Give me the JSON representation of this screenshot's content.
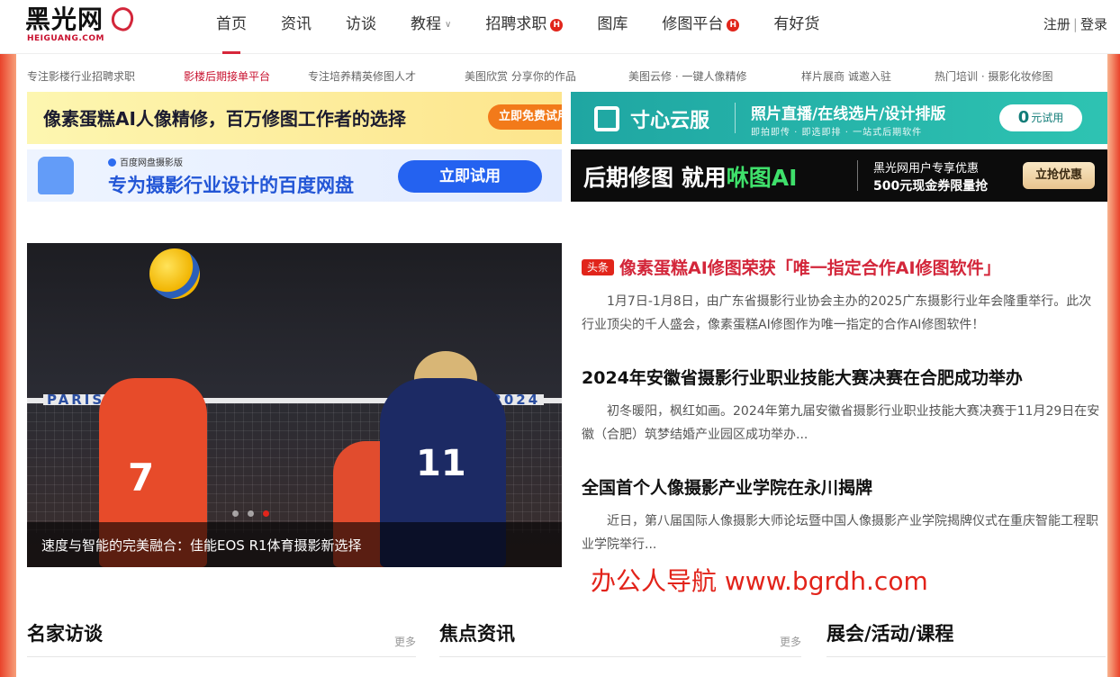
{
  "header": {
    "logo": {
      "main": "黑光网",
      "sub": "HEIGUANG.COM"
    },
    "nav": [
      {
        "label": "首页",
        "active": true,
        "badge": "",
        "dropdown": false
      },
      {
        "label": "资讯",
        "active": false,
        "badge": "",
        "dropdown": false
      },
      {
        "label": "访谈",
        "active": false,
        "badge": "",
        "dropdown": false
      },
      {
        "label": "教程",
        "active": false,
        "badge": "",
        "dropdown": true
      },
      {
        "label": "招聘求职",
        "active": false,
        "badge": "H",
        "dropdown": false
      },
      {
        "label": "图库",
        "active": false,
        "badge": "",
        "dropdown": false
      },
      {
        "label": "修图平台",
        "active": false,
        "badge": "H",
        "dropdown": false
      },
      {
        "label": "有好货",
        "active": false,
        "badge": "",
        "dropdown": false
      }
    ],
    "auth": {
      "register": "注册",
      "separator": "|",
      "login": "登录"
    }
  },
  "sublinks": [
    {
      "label": "专注影楼行业招聘求职",
      "hot": false
    },
    {
      "label": "影楼后期接单平台",
      "hot": true
    },
    {
      "label": "专注培养精英修图人才",
      "hot": false
    },
    {
      "label": "美图欣赏  分享你的作品",
      "hot": false
    },
    {
      "label": "美图云修 · 一键人像精修",
      "hot": false
    },
    {
      "label": "样片展商  诚邀入驻",
      "hot": false
    },
    {
      "label": "热门培训 · 摄影化妆修图",
      "hot": false
    }
  ],
  "banners": {
    "b1": {
      "text": "像素蛋糕AI人像精修，百万修图工作者的选择",
      "button": "立即免费试用"
    },
    "b2": {
      "name": "寸心云服",
      "slogan": "照片直播/在线选片/设计排版",
      "sub": "即拍即传 · 即选即排 · 一站式后期软件",
      "button_num": "0",
      "button_text": "元试用"
    },
    "b3": {
      "small": "百度网盘摄影版",
      "text": "专为摄影行业设计的百度网盘",
      "button": "立即试用"
    },
    "b4": {
      "title_a": "后期修图 就用",
      "title_b": "咻图AI",
      "line1": "黑光网用户专享优惠",
      "line2": "500元现金券限量抢",
      "button": "立抢优惠"
    }
  },
  "hero": {
    "caption": "速度与智能的完美融合：佳能EOS R1体育摄影新选择",
    "net_text": "PARIS 2024",
    "num_left": "7",
    "num_right": "11",
    "slides": 3,
    "active_slide": 3
  },
  "news": [
    {
      "tag": "头条",
      "title": "像素蛋糕AI修图荣获「唯一指定合作AI修图软件」",
      "summary": "1月7日-1月8日，由广东省摄影行业协会主办的2025广东摄影行业年会隆重举行。此次行业顶尖的千人盛会，像素蛋糕AI修图作为唯一指定的合作AI修图软件！"
    },
    {
      "tag": "",
      "title": "2024年安徽省摄影行业职业技能大赛决赛在合肥成功举办",
      "summary": "初冬暖阳，枫红如画。2024年第九届安徽省摄影行业职业技能大赛决赛于11月29日在安徽（合肥）筑梦结婚产业园区成功举办..."
    },
    {
      "tag": "",
      "title": "全国首个人像摄影产业学院在永川揭牌",
      "summary": "近日，第八届国际人像摄影大师论坛暨中国人像摄影产业学院揭牌仪式在重庆智能工程职业学院举行..."
    }
  ],
  "watermark": "办公人导航 www.bgrdh.com",
  "sections": [
    {
      "title": "名家访谈",
      "more": "更多"
    },
    {
      "title": "焦点资讯",
      "more": "更多"
    },
    {
      "title": "展会/活动/课程",
      "more": ""
    }
  ],
  "colors": {
    "accent": "#d7263a",
    "badge": "#e1251b",
    "teal": "#1fa6a2",
    "blue": "#2462f0"
  }
}
